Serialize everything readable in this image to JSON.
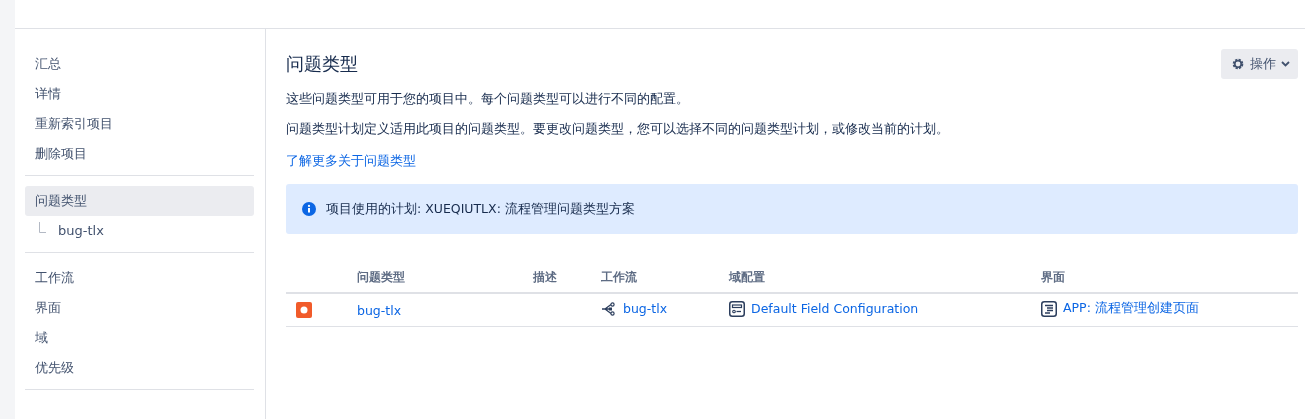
{
  "sidebar": {
    "groups": [
      {
        "items": [
          {
            "label": "汇总",
            "selected": false
          },
          {
            "label": "详情",
            "selected": false
          },
          {
            "label": "重新索引项目",
            "selected": false
          },
          {
            "label": "删除项目",
            "selected": false
          }
        ]
      },
      {
        "items": [
          {
            "label": "问题类型",
            "selected": true,
            "children": [
              {
                "label": "bug-tlx",
                "selected": false
              }
            ]
          }
        ]
      },
      {
        "items": [
          {
            "label": "工作流",
            "selected": false
          },
          {
            "label": "界面",
            "selected": false
          },
          {
            "label": "域",
            "selected": false
          },
          {
            "label": "优先级",
            "selected": false
          }
        ]
      }
    ]
  },
  "main": {
    "title": "问题类型",
    "actions_button": "操作",
    "description": "这些问题类型可用于您的项目中。每个问题类型可以进行不同的配置。",
    "scheme_note": "问题类型计划定义适用此项目的问题类型。要更改问题类型，您可以选择不同的问题类型计划，或修改当前的计划。",
    "learn_more_link": "了解更多关于问题类型",
    "info_banner": "项目使用的计划: XUEQIUTLX: 流程管理问题类型方案"
  },
  "table": {
    "columns": [
      "问题类型",
      "描述",
      "工作流",
      "域配置",
      "界面"
    ],
    "rows": [
      {
        "issue_type": "bug-tlx",
        "description": "",
        "workflow": "bug-tlx",
        "field_configuration": "Default Field Configuration",
        "screen": "APP: 流程管理创建页面"
      }
    ]
  }
}
